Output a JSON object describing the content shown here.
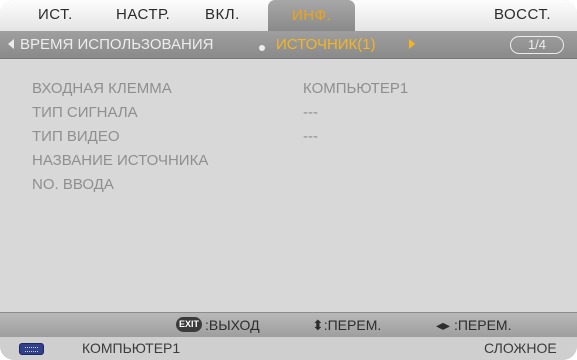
{
  "tabs": [
    {
      "label": "ИСТ.",
      "active": false
    },
    {
      "label": "НАСТР.",
      "active": false
    },
    {
      "label": "ВКЛ.",
      "active": false
    },
    {
      "label": "ИНФ.",
      "active": true
    },
    {
      "label": "ВОССТ.",
      "active": false
    }
  ],
  "subheader": {
    "prev_label": "ВРЕМЯ ИСПОЛЬЗОВАНИЯ",
    "current_label": "ИСТОЧНИК(1)",
    "page": "1/4"
  },
  "rows": [
    {
      "label": "ВХОДНАЯ КЛЕММА",
      "value": "КОМПЬЮТЕР1"
    },
    {
      "label": "ТИП СИГНАЛА",
      "value": "---"
    },
    {
      "label": "ТИП ВИДЕО",
      "value": "---"
    },
    {
      "label": "НАЗВАНИЕ ИСТОЧНИКА",
      "value": ""
    },
    {
      "label": "NO. ВВОДА",
      "value": ""
    }
  ],
  "helpbar": {
    "exit_badge": "EXIT",
    "exit_label": ":ВЫХОД",
    "updown_label": "⬍:ПЕРЕМ.",
    "leftright_label": "◂▸ :ПЕРЕМ."
  },
  "status": {
    "source": "КОМПЬЮТЕР1",
    "mode": "СЛОЖНОЕ"
  },
  "colors": {
    "accent": "#f1a411",
    "active_tab_bg": "#9a9a9a",
    "content_bg": "#d8d8d8",
    "muted_text": "#8f8f8f"
  }
}
